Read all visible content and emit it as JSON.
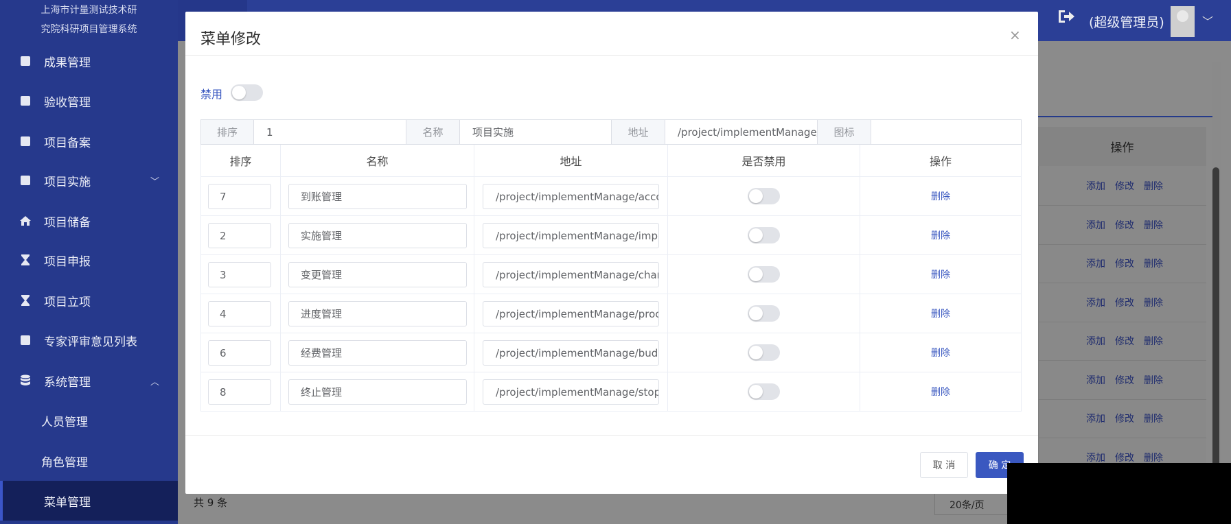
{
  "sidebar": {
    "title_line1": "上海市计量测试技术研",
    "title_line2": "究院科研项目管理系统",
    "items": [
      {
        "label": "成果管理",
        "icon": "square-icon"
      },
      {
        "label": "验收管理",
        "icon": "square-icon"
      },
      {
        "label": "项目备案",
        "icon": "square-icon"
      },
      {
        "label": "项目实施",
        "icon": "square-icon",
        "chevron": "﹀"
      },
      {
        "label": "项目储备",
        "icon": "home-icon"
      },
      {
        "label": "项目申报",
        "icon": "hourglass-icon"
      },
      {
        "label": "项目立项",
        "icon": "hourglass-icon"
      },
      {
        "label": "专家评审意见列表",
        "icon": "square-icon"
      },
      {
        "label": "系统管理",
        "icon": "database-icon",
        "chevron": "︿"
      },
      {
        "label": "人员管理"
      },
      {
        "label": "角色管理"
      },
      {
        "label": "菜单管理",
        "active": true
      }
    ]
  },
  "header": {
    "role": "(超级管理员)"
  },
  "background": {
    "ops_header": "操作",
    "row_actions": [
      "添加",
      "修改",
      "删除"
    ],
    "total": "共 9 条",
    "page_size": "20条/页"
  },
  "dialog": {
    "title": "菜单修改",
    "close": "×",
    "disable_label": "禁用",
    "form": {
      "order_label": "排序",
      "order_value": "1",
      "name_label": "名称",
      "name_value": "项目实施",
      "path_label": "地址",
      "path_value": "/project/implementManage/i",
      "icon_label": "图标",
      "icon_value": ""
    },
    "columns": [
      "排序",
      "名称",
      "地址",
      "是否禁用",
      "操作"
    ],
    "rows": [
      {
        "order": "7",
        "name": "到账管理",
        "path": "/project/implementManage/accou",
        "action": "删除"
      },
      {
        "order": "2",
        "name": "实施管理",
        "path": "/project/implementManage/imple",
        "action": "删除"
      },
      {
        "order": "3",
        "name": "变更管理",
        "path": "/project/implementManage/chang",
        "action": "删除"
      },
      {
        "order": "4",
        "name": "进度管理",
        "path": "/project/implementManage/proce",
        "action": "删除"
      },
      {
        "order": "6",
        "name": "经费管理",
        "path": "/project/implementManage/budge",
        "action": "删除"
      },
      {
        "order": "8",
        "name": "终止管理",
        "path": "/project/implementManage/stopL",
        "action": "删除"
      }
    ],
    "cancel": "取 消",
    "ok": "确 定"
  },
  "colors": {
    "primary": "#3a58c0",
    "sidebar": "#26398c"
  }
}
